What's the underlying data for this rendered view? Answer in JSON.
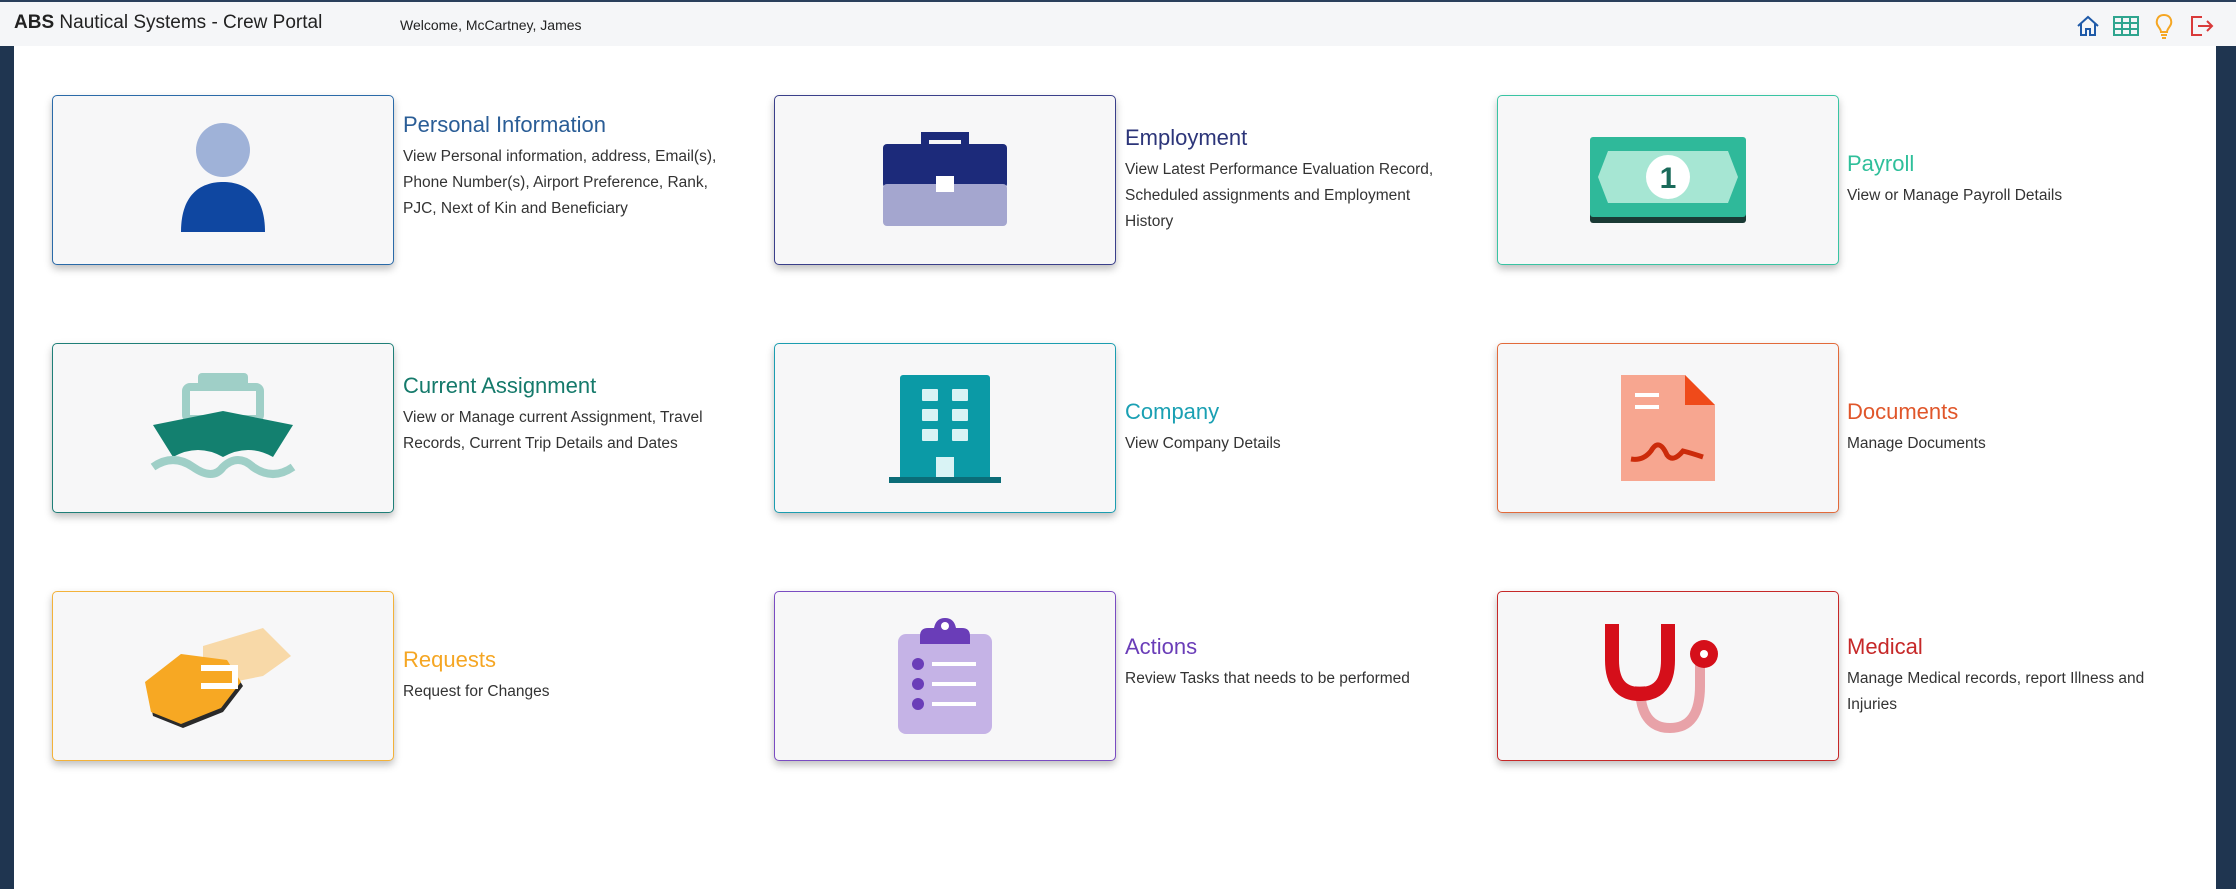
{
  "header": {
    "brand_bold": "ABS",
    "brand_rest": " Nautical Systems - Crew Portal",
    "welcome": "Welcome, McCartney, James",
    "icons": [
      "home-icon",
      "grid-icon",
      "lightbulb-icon",
      "logout-icon"
    ]
  },
  "tiles": [
    {
      "title": "Personal Information",
      "desc": "View Personal information, address, Email(s), Phone Number(s), Airport Preference, Rank, PJC, Next of Kin and Beneficiary",
      "color": "#2a5d96",
      "border": "#2a6aa8",
      "icon": "person-icon"
    },
    {
      "title": "Employment",
      "desc": "View Latest Performance Evaluation Record, Scheduled assignments and Employment History",
      "color": "#2c3579",
      "border": "#3a3f8a",
      "icon": "briefcase-icon"
    },
    {
      "title": "Payroll",
      "desc": "View or Manage Payroll Details",
      "color": "#2fbf9a",
      "border": "#39c4a3",
      "icon": "money-icon"
    },
    {
      "title": "Current Assignment",
      "desc": "View or Manage current Assignment, Travel Records, Current Trip Details and Dates",
      "color": "#157a6b",
      "border": "#1f7f78",
      "icon": "ship-icon"
    },
    {
      "title": "Company",
      "desc": "View Company Details",
      "color": "#1aa0b3",
      "border": "#1b9db0",
      "icon": "building-icon"
    },
    {
      "title": "Documents",
      "desc": "Manage Documents",
      "color": "#e0562a",
      "border": "#e26a3a",
      "icon": "document-icon"
    },
    {
      "title": "Requests",
      "desc": "Request for Changes",
      "color": "#f5a623",
      "border": "#f3b23a",
      "icon": "handshake-icon"
    },
    {
      "title": "Actions",
      "desc": "Review Tasks that needs to be performed",
      "color": "#6a3db8",
      "border": "#7a4cc2",
      "icon": "clipboard-icon"
    },
    {
      "title": "Medical",
      "desc": "Manage Medical records, report Illness and Injuries",
      "color": "#c62828",
      "border": "#c62828",
      "icon": "stethoscope-icon"
    }
  ]
}
